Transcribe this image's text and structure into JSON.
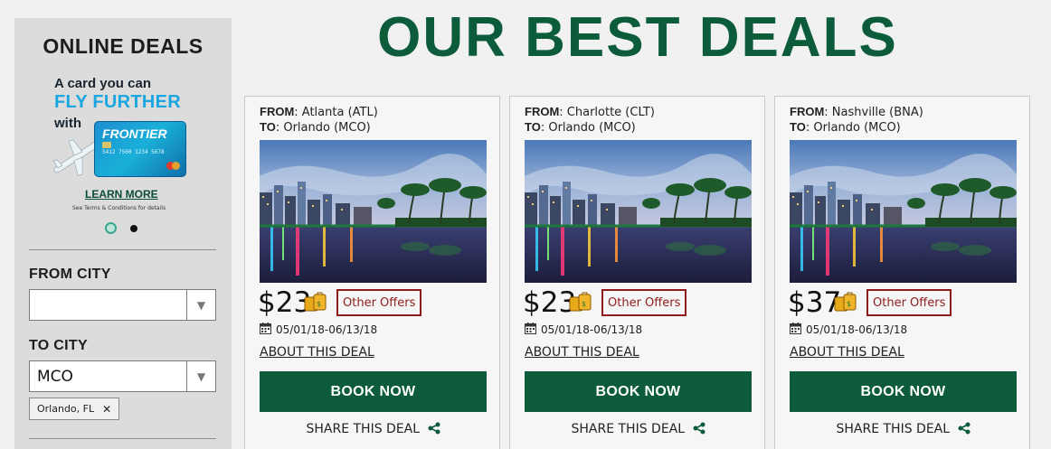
{
  "sidebar": {
    "title": "ONLINE DEALS",
    "promo": {
      "line1": "A card you can",
      "line2": "FLY FURTHER",
      "line3": "with",
      "card_brand": "FRONTIER",
      "card_number": "5412 7500 1234 5678",
      "learn_more": "LEARN MORE",
      "terms": "See Terms & Conditions for details"
    },
    "from_city": {
      "label": "FROM CITY",
      "value": ""
    },
    "to_city": {
      "label": "TO CITY",
      "value": "MCO"
    },
    "selected_tag": "Orlando, FL"
  },
  "main": {
    "title": "OUR BEST DEALS",
    "from_label": "FROM",
    "to_label": "TO",
    "other_offers": "Other Offers",
    "about": "ABOUT THIS DEAL",
    "book": "BOOK NOW",
    "share": "SHARE THIS DEAL",
    "deals": [
      {
        "from": ": Atlanta (ATL)",
        "to": ": Orlando (MCO)",
        "price": "$23",
        "dates": "05/01/18-06/13/18"
      },
      {
        "from": ": Charlotte (CLT)",
        "to": ": Orlando (MCO)",
        "price": "$23",
        "dates": "05/01/18-06/13/18"
      },
      {
        "from": ": Nashville (BNA)",
        "to": ": Orlando (MCO)",
        "price": "$37",
        "dates": "05/01/18-06/13/18"
      }
    ]
  },
  "colors": {
    "brand_green": "#0c5c3c",
    "offer_red": "#8c1c1c",
    "promo_blue": "#1aa6e0"
  }
}
